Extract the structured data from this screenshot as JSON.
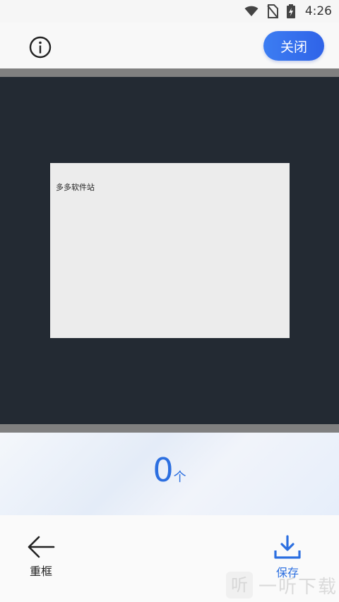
{
  "status_bar": {
    "time": "4:26"
  },
  "top_bar": {
    "close_label": "关闭"
  },
  "document": {
    "text": "多多软件站"
  },
  "counter": {
    "value": "0",
    "unit": "个"
  },
  "bottom_bar": {
    "redo_label": "重框",
    "save_label": "保存"
  },
  "watermark": {
    "logo_text": "听",
    "text": "一听下载"
  },
  "colors": {
    "accent": "#2f6ee6",
    "preview_bg": "#232a33"
  }
}
